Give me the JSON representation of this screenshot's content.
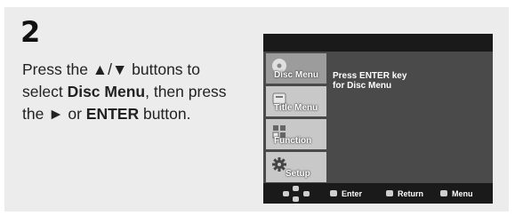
{
  "step_number": "2",
  "instruction": {
    "part1": "Press the ▲/▼ buttons to select ",
    "bold1": "Disc Menu",
    "part2": ", then press the ► or ",
    "bold2": "ENTER",
    "part3": " button."
  },
  "screen": {
    "menu_items": [
      {
        "label": "Disc Menu",
        "icon": "disc-icon",
        "active": true
      },
      {
        "label": "Title Menu",
        "icon": "title-icon",
        "active": false
      },
      {
        "label": "Function",
        "icon": "function-icon",
        "active": false
      },
      {
        "label": "Setup",
        "icon": "gear-icon",
        "active": false
      }
    ],
    "message_line1": "Press ENTER key",
    "message_line2": "for Disc Menu",
    "bottom_bar": {
      "enter_label": "Enter",
      "return_label": "Return",
      "menu_label": "Menu"
    }
  }
}
